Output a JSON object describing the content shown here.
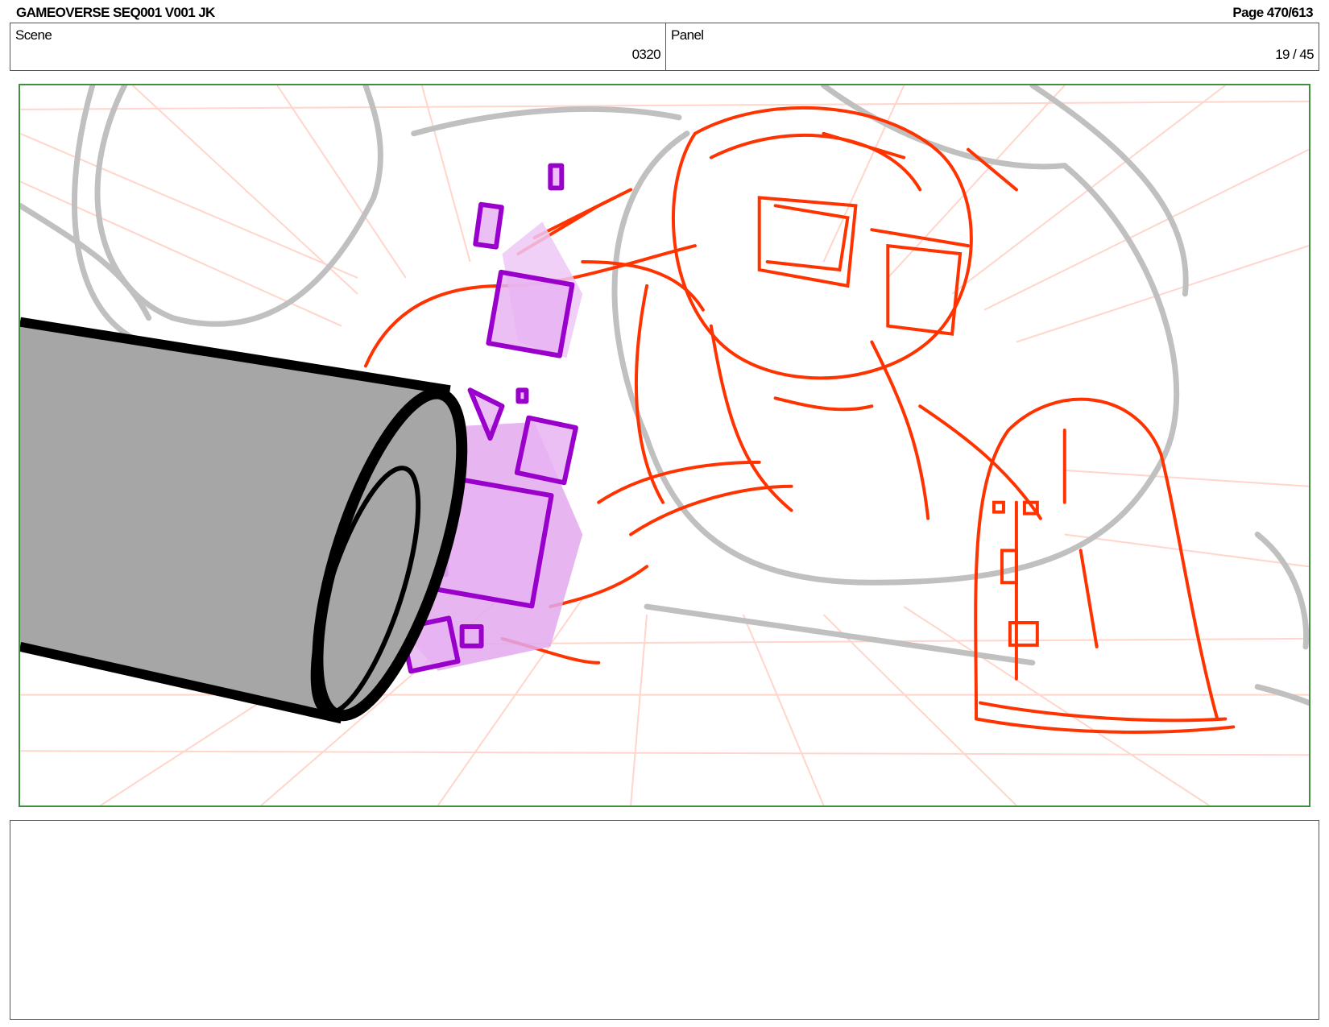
{
  "header": {
    "title": "GAMEOVERSE SEQ001 V001 JK",
    "page": "Page 470/613"
  },
  "info": {
    "scene_label": "Scene",
    "scene_value": "0320",
    "panel_label": "Panel",
    "panel_value": "19 / 45"
  },
  "notes": {
    "text": ""
  },
  "colors": {
    "frame_border": "#3f8f3f",
    "sketch_red": "#ff3300",
    "sketch_purple": "#9900cc",
    "sketch_gray": "#c0c0c0",
    "grid_pink": "#ffd5cc",
    "cylinder_fill": "#a6a6a6"
  }
}
